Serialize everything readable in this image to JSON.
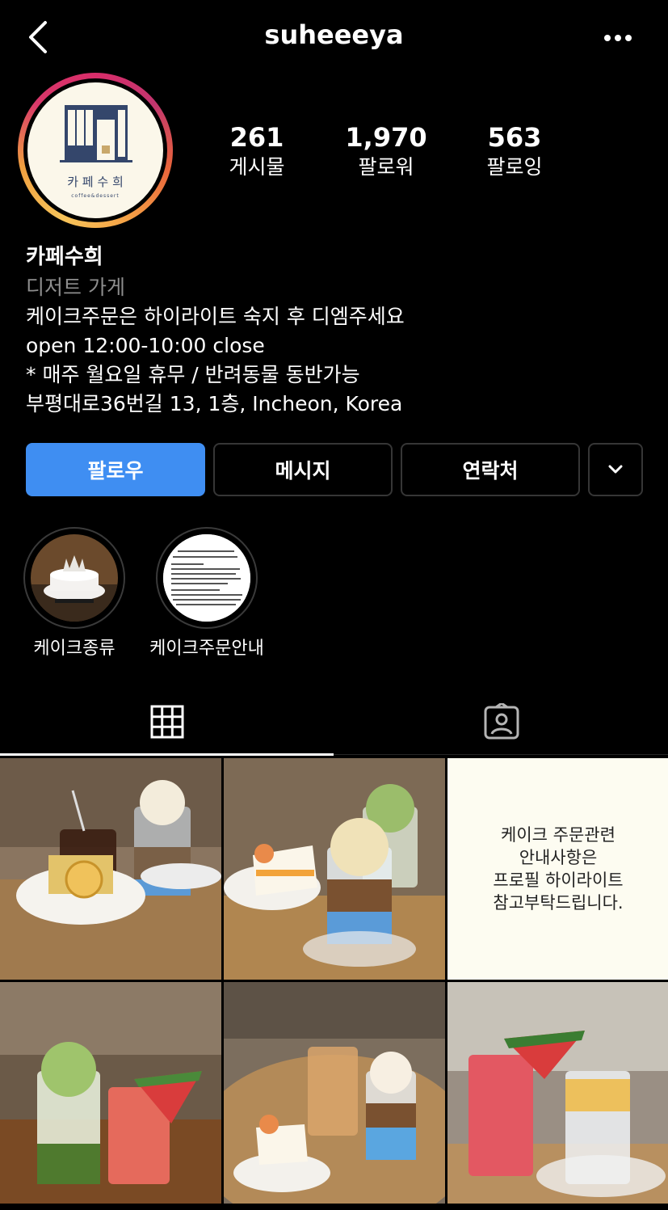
{
  "header": {
    "username": "suheeeya",
    "back_icon": "chevron-left-icon",
    "more_icon": "more-horizontal-icon"
  },
  "avatar": {
    "logo_text": "카 페 수 희",
    "logo_sub": "coffee&dessert"
  },
  "stats": [
    {
      "value": "261",
      "label": "게시물"
    },
    {
      "value": "1,970",
      "label": "팔로워"
    },
    {
      "value": "563",
      "label": "팔로잉"
    }
  ],
  "bio": {
    "name": "카페수희",
    "category": "디저트 가게",
    "lines": [
      "케이크주문은 하이라이트 숙지 후 디엠주세요",
      "open 12:00-10:00 close",
      "* 매주 월요일 휴무 / 반려동물 동반가능",
      "부평대로36번길 13, 1층, Incheon, Korea"
    ]
  },
  "buttons": {
    "follow": "팔로우",
    "message": "메시지",
    "contact": "연락처"
  },
  "highlights": [
    {
      "label": "케이크종류"
    },
    {
      "label": "케이크주문안내"
    }
  ],
  "tabs": {
    "grid_icon": "grid-icon",
    "tagged_icon": "tagged-person-icon"
  },
  "notice_post": {
    "lines": [
      "케이크 주문관련",
      "안내사항은",
      "프로필 하이라이트",
      "참고부탁드립니다."
    ]
  },
  "colors": {
    "follow_button": "#3f8ef2",
    "secondary_text": "#8e8e8e",
    "background": "#000000"
  }
}
